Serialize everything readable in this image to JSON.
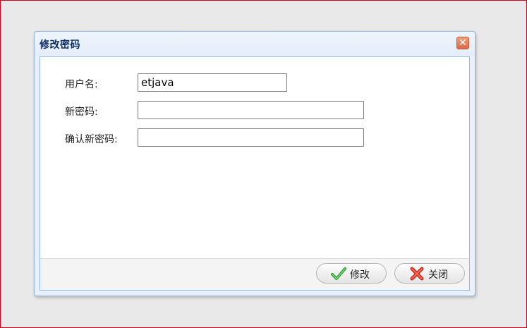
{
  "dialog": {
    "title": "修改密码",
    "close_icon": "close-icon",
    "close_glyph": "✕"
  },
  "form": {
    "username_label": "用户名:",
    "username_value": "etjava",
    "new_password_label": "新密码:",
    "new_password_value": "",
    "confirm_password_label": "确认新密码:",
    "confirm_password_value": ""
  },
  "footer": {
    "modify_label": "修改",
    "modify_icon": "check-icon",
    "close_label": "关闭",
    "close_icon": "cross-icon"
  },
  "colors": {
    "title_text": "#0e2d5f",
    "dialog_border": "#95b8e7",
    "frame_border": "#d0021b",
    "check_green": "#3aa33a",
    "cross_red": "#d93a2b"
  }
}
